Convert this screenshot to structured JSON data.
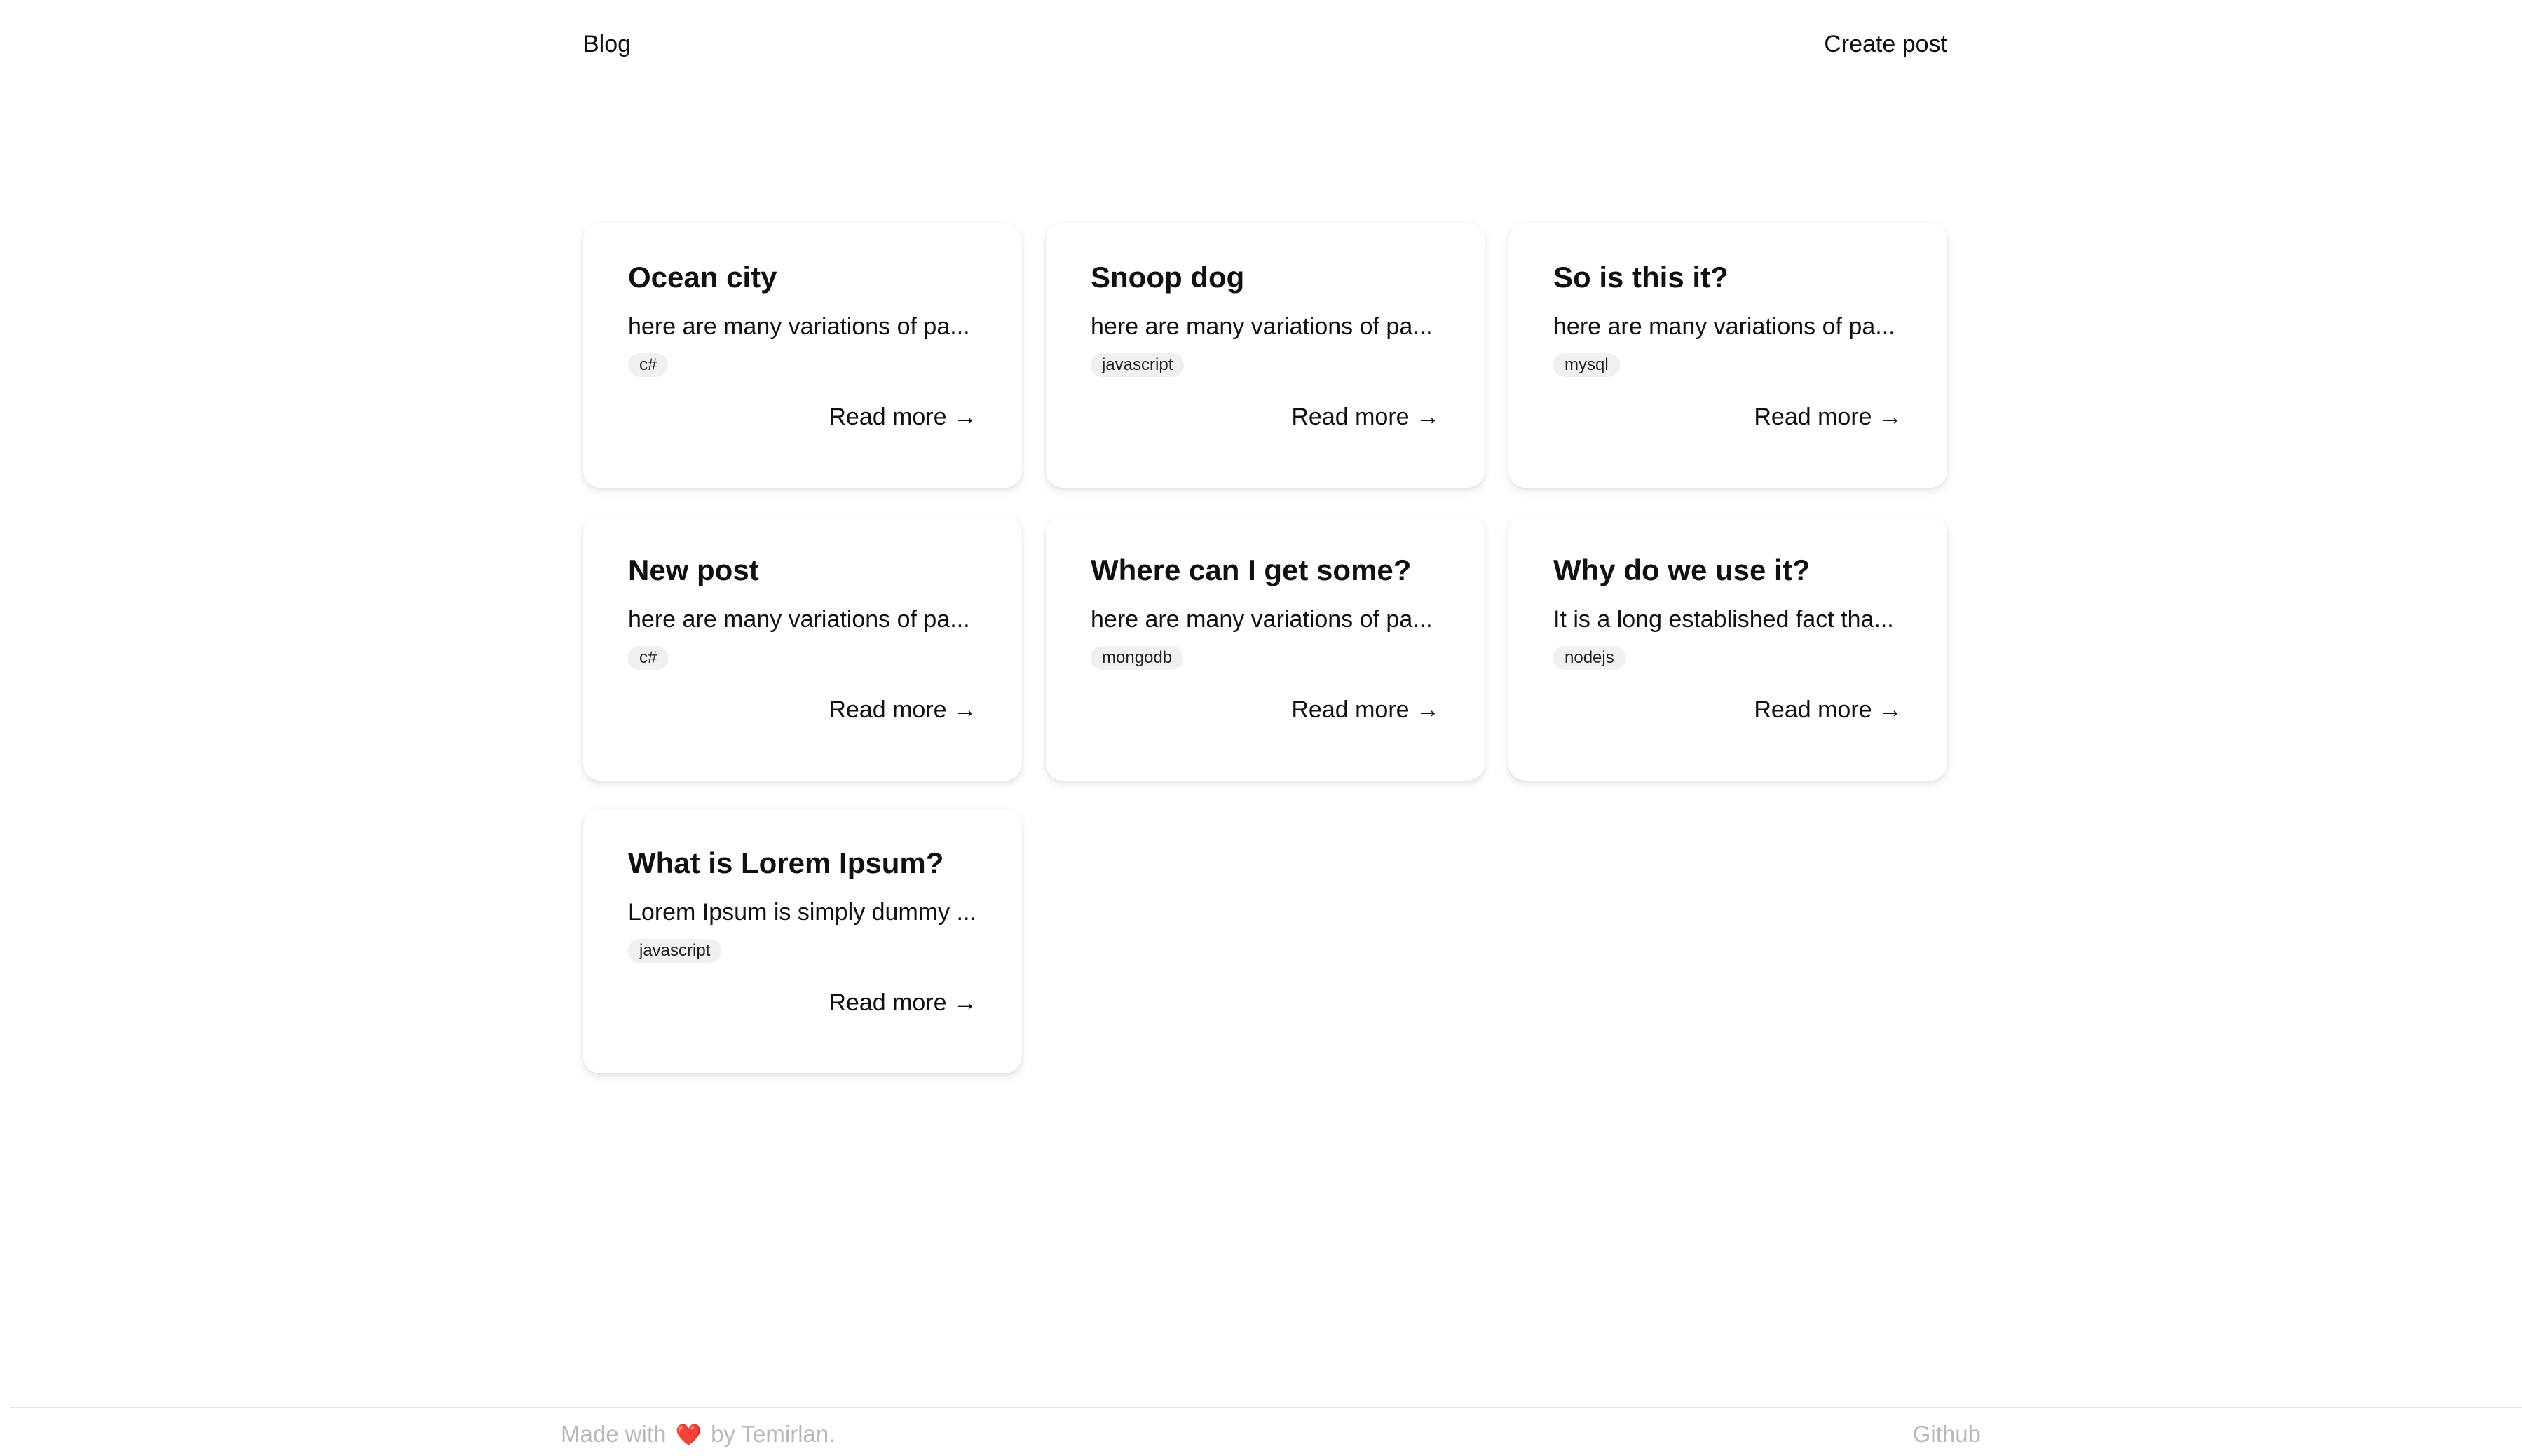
{
  "header": {
    "brand": "Blog",
    "create_post": "Create post"
  },
  "posts": [
    {
      "title": "Ocean city",
      "excerpt": "here are many variations of pa...",
      "tag": "c#",
      "read_more": "Read more →"
    },
    {
      "title": "Snoop dog",
      "excerpt": "here are many variations of pa...",
      "tag": "javascript",
      "read_more": "Read more →"
    },
    {
      "title": "So is this it?",
      "excerpt": "here are many variations of pa...",
      "tag": "mysql",
      "read_more": "Read more →"
    },
    {
      "title": "New post",
      "excerpt": "here are many variations of pa...",
      "tag": "c#",
      "read_more": "Read more →"
    },
    {
      "title": "Where can I get some?",
      "excerpt": "here are many variations of pa...",
      "tag": "mongodb",
      "read_more": "Read more →"
    },
    {
      "title": "Why do we use it?",
      "excerpt": "It is a long established fact tha...",
      "tag": "nodejs",
      "read_more": "Read more →"
    },
    {
      "title": "What is Lorem Ipsum?",
      "excerpt": "Lorem Ipsum is simply dummy ...",
      "tag": "javascript",
      "read_more": "Read more →"
    }
  ],
  "footer": {
    "made_with_prefix": "Made with",
    "heart_icon": "❤️",
    "made_with_suffix": "by Temirlan.",
    "github": "Github"
  },
  "colors": {
    "text": "#111111",
    "tag_bg": "#f0f0f0",
    "footer_text": "#b8b8b8",
    "heart": "#e0533d"
  }
}
